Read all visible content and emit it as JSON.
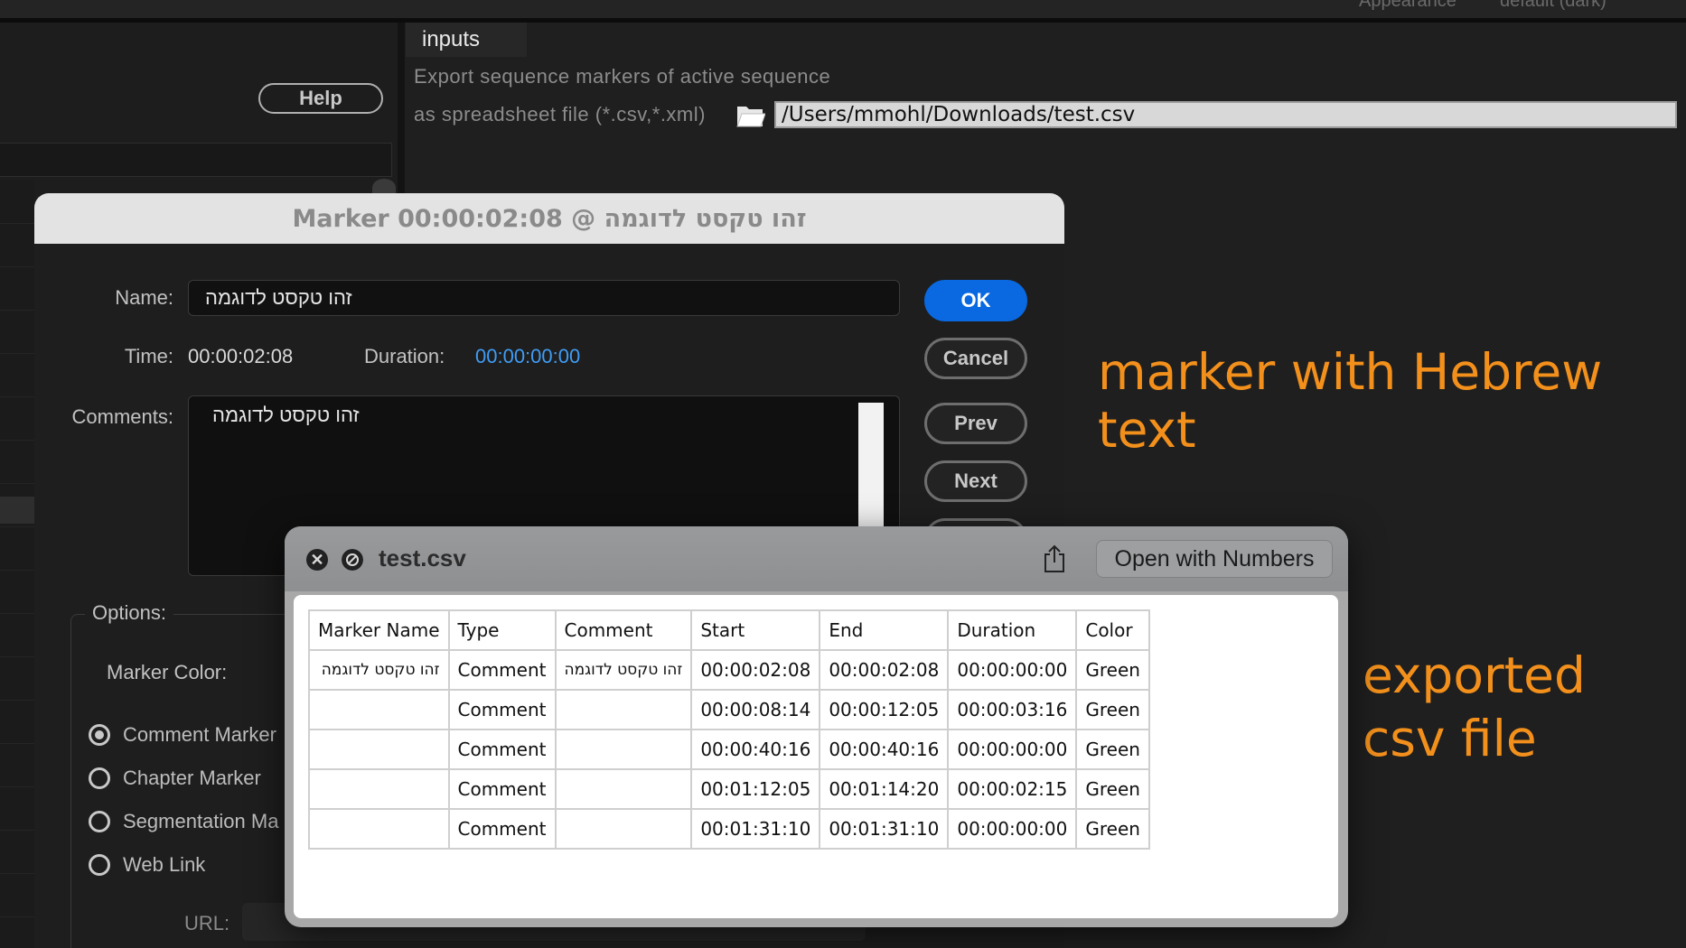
{
  "topbar": {
    "appearance_label": "Appearance",
    "appearance_value": "default (dark)"
  },
  "left_panel": {
    "help_label": "Help"
  },
  "inputs_panel": {
    "tab_label": "inputs",
    "export_line1": "Export sequence markers of active sequence",
    "export_line2": "as spreadsheet file (*.csv,*.xml)",
    "path_value": "/Users/mmohl/Downloads/test.csv"
  },
  "annotations": {
    "marker_note": "marker with Hebrew text",
    "csv_note_line1": "exported",
    "csv_note_line2": "csv file",
    "color": "#f3901c"
  },
  "marker_dialog": {
    "title": "Marker 00:00:02:08 @ זהו טקסט לדוגמה",
    "name_label": "Name:",
    "name_value": "זהו טקסט לדוגמה",
    "time_label": "Time:",
    "time_value": "00:00:02:08",
    "duration_label": "Duration:",
    "duration_value": "00:00:00:00",
    "comments_label": "Comments:",
    "comments_value": "זהו טקסט לדוגמה",
    "buttons": {
      "ok": "OK",
      "cancel": "Cancel",
      "prev": "Prev",
      "next": "Next"
    },
    "options_label": "Options:",
    "marker_color_label": "Marker Color:",
    "marker_types": [
      {
        "label": "Comment Marker",
        "selected": true
      },
      {
        "label": "Chapter Marker",
        "selected": false
      },
      {
        "label": "Segmentation Ma",
        "selected": false
      },
      {
        "label": "Web Link",
        "selected": false
      }
    ],
    "url_label": "URL:",
    "accent_color": "#0a68e0",
    "duration_color": "#3f9cf5"
  },
  "quicklook": {
    "title": "test.csv",
    "open_with_label": "Open with Numbers",
    "headers": [
      "Marker Name",
      "Type",
      "Comment",
      "Start",
      "End",
      "Duration",
      "Color"
    ],
    "rows": [
      [
        "זהו טקסט לדוגמה",
        "Comment",
        "זהו טקסט לדוגמה",
        "00:00:02:08",
        "00:00:02:08",
        "00:00:00:00",
        "Green"
      ],
      [
        "",
        "Comment",
        "",
        "00:00:08:14",
        "00:00:12:05",
        "00:00:03:16",
        "Green"
      ],
      [
        "",
        "Comment",
        "",
        "00:00:40:16",
        "00:00:40:16",
        "00:00:00:00",
        "Green"
      ],
      [
        "",
        "Comment",
        "",
        "00:01:12:05",
        "00:01:14:20",
        "00:00:02:15",
        "Green"
      ],
      [
        "",
        "Comment",
        "",
        "00:01:31:10",
        "00:01:31:10",
        "00:00:00:00",
        "Green"
      ]
    ]
  }
}
